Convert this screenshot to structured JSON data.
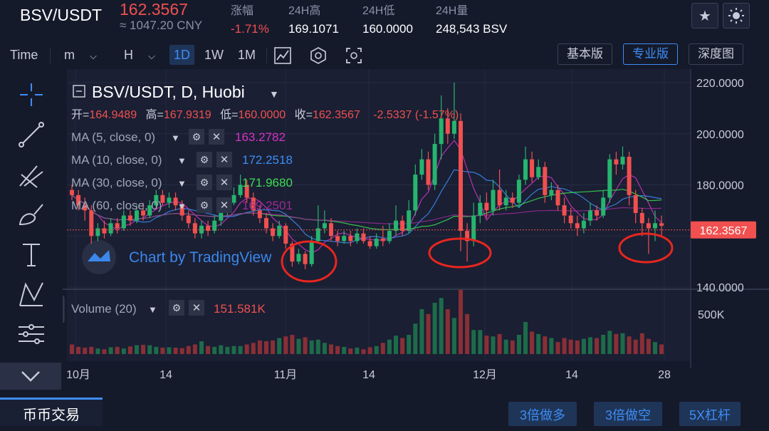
{
  "header": {
    "pair": "BSV/USDT",
    "price": "162.3567",
    "cny": "≈ 1047.20 CNY",
    "stats": [
      {
        "label": "涨幅",
        "value": "-1.71%",
        "down": true
      },
      {
        "label": "24H高",
        "value": "169.1071",
        "down": false
      },
      {
        "label": "24H低",
        "value": "160.0000",
        "down": false
      },
      {
        "label": "24H量",
        "value": "248,543 BSV",
        "down": false
      }
    ]
  },
  "toolbar": {
    "time_label": "Time",
    "minute_label": "m",
    "hour_label": "H",
    "intervals": [
      "1D",
      "1W",
      "1M"
    ],
    "active_interval": "1D",
    "versions": [
      "基本版",
      "专业版",
      "深度图"
    ],
    "active_version": "专业版"
  },
  "legend": {
    "symbol": "BSV/USDT, D, Huobi",
    "ohlc": {
      "o_label": "开=",
      "o": "164.9489",
      "h_label": "高=",
      "h": "167.9319",
      "l_label": "低=",
      "l": "160.0000",
      "c_label": "收=",
      "c": "162.3567",
      "change": "-2.5337 (-1.57%)"
    },
    "indicators": [
      {
        "name": "MA (5, close, 0)",
        "value": "163.2782",
        "color": "#d534c6"
      },
      {
        "name": "MA (10, close, 0)",
        "value": "172.2518",
        "color": "#3d8df5"
      },
      {
        "name": "MA (30, close, 0)",
        "value": "171.9680",
        "color": "#3ddc52"
      },
      {
        "name": "MA (60, close, 0)",
        "value": "169.2501",
        "color": "#9b2a96"
      }
    ],
    "volume": {
      "name": "Volume (20)",
      "value": "151.581K",
      "color": "#f0504f"
    }
  },
  "watermark": "Chart by TradingView",
  "price_axis": {
    "ticks": [
      "220.0000",
      "200.0000",
      "180.0000",
      "140.0000"
    ],
    "last_price": "162.3567"
  },
  "volume_axis": {
    "ticks": [
      "500K"
    ]
  },
  "time_axis": {
    "ticks": [
      "10月",
      "14",
      "11月",
      "14",
      "12月",
      "14",
      "28"
    ]
  },
  "chart_data": {
    "type": "candlestick",
    "price_range": [
      140,
      220
    ],
    "volume_max": 800000,
    "candles": [
      [
        178,
        176,
        180,
        174
      ],
      [
        176,
        172,
        178,
        170
      ],
      [
        172,
        170,
        175,
        166
      ],
      [
        170,
        160,
        172,
        157
      ],
      [
        160,
        163,
        165,
        158
      ],
      [
        163,
        161,
        166,
        159
      ],
      [
        161,
        165,
        167,
        160
      ],
      [
        165,
        163,
        167,
        161
      ],
      [
        163,
        168,
        170,
        162
      ],
      [
        168,
        166,
        170,
        164
      ],
      [
        166,
        170,
        172,
        165
      ],
      [
        170,
        168,
        173,
        166
      ],
      [
        168,
        172,
        174,
        167
      ],
      [
        172,
        176,
        178,
        171
      ],
      [
        176,
        173,
        178,
        172
      ],
      [
        173,
        175,
        177,
        171
      ],
      [
        175,
        172,
        177,
        170
      ],
      [
        172,
        168,
        174,
        166
      ],
      [
        168,
        165,
        170,
        163
      ],
      [
        165,
        161,
        167,
        159
      ],
      [
        161,
        164,
        166,
        159
      ],
      [
        164,
        162,
        166,
        160
      ],
      [
        162,
        166,
        168,
        161
      ],
      [
        166,
        170,
        172,
        164
      ],
      [
        170,
        173,
        175,
        168
      ],
      [
        173,
        176,
        179,
        172
      ],
      [
        176,
        180,
        184,
        175
      ],
      [
        180,
        175,
        182,
        173
      ],
      [
        175,
        170,
        177,
        168
      ],
      [
        170,
        167,
        172,
        165
      ],
      [
        167,
        163,
        169,
        161
      ],
      [
        163,
        160,
        165,
        158
      ],
      [
        160,
        164,
        166,
        159
      ],
      [
        164,
        157,
        165,
        155
      ],
      [
        157,
        150,
        158,
        148
      ],
      [
        150,
        153,
        155,
        149
      ],
      [
        153,
        149,
        154,
        147
      ],
      [
        149,
        158,
        160,
        148
      ],
      [
        158,
        163,
        172,
        157
      ],
      [
        163,
        165,
        170,
        161
      ],
      [
        165,
        160,
        167,
        158
      ],
      [
        160,
        158,
        162,
        156
      ],
      [
        158,
        160,
        162,
        157
      ],
      [
        160,
        158,
        162,
        156
      ],
      [
        158,
        161,
        163,
        157
      ],
      [
        161,
        158,
        163,
        157
      ],
      [
        158,
        156,
        160,
        155
      ],
      [
        156,
        159,
        161,
        155
      ],
      [
        159,
        158,
        164,
        156
      ],
      [
        158,
        162,
        165,
        157
      ],
      [
        162,
        166,
        172,
        160
      ],
      [
        166,
        162,
        168,
        160
      ],
      [
        162,
        170,
        174,
        161
      ],
      [
        170,
        184,
        188,
        168
      ],
      [
        184,
        190,
        194,
        182
      ],
      [
        190,
        180,
        193,
        178
      ],
      [
        180,
        196,
        200,
        178
      ],
      [
        196,
        206,
        215,
        190
      ],
      [
        206,
        200,
        210,
        196
      ],
      [
        200,
        205,
        220,
        198
      ],
      [
        205,
        162,
        208,
        154
      ],
      [
        162,
        158,
        165,
        150
      ],
      [
        158,
        168,
        173,
        156
      ],
      [
        168,
        173,
        176,
        165
      ],
      [
        173,
        170,
        177,
        167
      ],
      [
        170,
        178,
        182,
        168
      ],
      [
        178,
        172,
        186,
        170
      ],
      [
        172,
        175,
        178,
        170
      ],
      [
        175,
        173,
        177,
        171
      ],
      [
        173,
        182,
        184,
        171
      ],
      [
        182,
        190,
        195,
        180
      ],
      [
        190,
        183,
        193,
        181
      ],
      [
        183,
        187,
        190,
        182
      ],
      [
        187,
        176,
        189,
        173
      ],
      [
        176,
        178,
        181,
        174
      ],
      [
        178,
        172,
        180,
        170
      ],
      [
        172,
        168,
        175,
        165
      ],
      [
        168,
        165,
        171,
        163
      ],
      [
        165,
        163,
        168,
        160
      ],
      [
        163,
        166,
        169,
        161
      ],
      [
        166,
        170,
        173,
        164
      ],
      [
        170,
        168,
        172,
        166
      ],
      [
        168,
        175,
        178,
        167
      ],
      [
        175,
        190,
        192,
        173
      ],
      [
        190,
        188,
        193,
        184
      ],
      [
        188,
        191,
        195,
        186
      ],
      [
        191,
        176,
        193,
        172
      ],
      [
        176,
        169,
        178,
        165
      ],
      [
        169,
        165,
        171,
        160
      ],
      [
        165,
        163,
        167,
        153
      ],
      [
        163,
        165,
        170,
        158
      ],
      [
        165,
        164,
        168,
        160
      ]
    ],
    "volumes": [
      120,
      90,
      80,
      90,
      70,
      60,
      85,
      90,
      70,
      95,
      110,
      115,
      110,
      90,
      80,
      85,
      80,
      75,
      100,
      120,
      160,
      100,
      90,
      110,
      90,
      100,
      100,
      120,
      140,
      170,
      160,
      170,
      200,
      220,
      240,
      190,
      210,
      170,
      180,
      140,
      120,
      100,
      90,
      70,
      80,
      60,
      85,
      100,
      140,
      180,
      230,
      200,
      240,
      380,
      560,
      500,
      640,
      700,
      560,
      450,
      800,
      500,
      300,
      300,
      230,
      220,
      250,
      180,
      170,
      240,
      400,
      280,
      250,
      220,
      200,
      150,
      200,
      180,
      170,
      190,
      210,
      200,
      240,
      290,
      250,
      260,
      220,
      180,
      260,
      190,
      150,
      120
    ]
  },
  "bottom": {
    "tab": "币币交易",
    "buttons": [
      "3倍做多",
      "3倍做空",
      "5X杠杆"
    ]
  }
}
